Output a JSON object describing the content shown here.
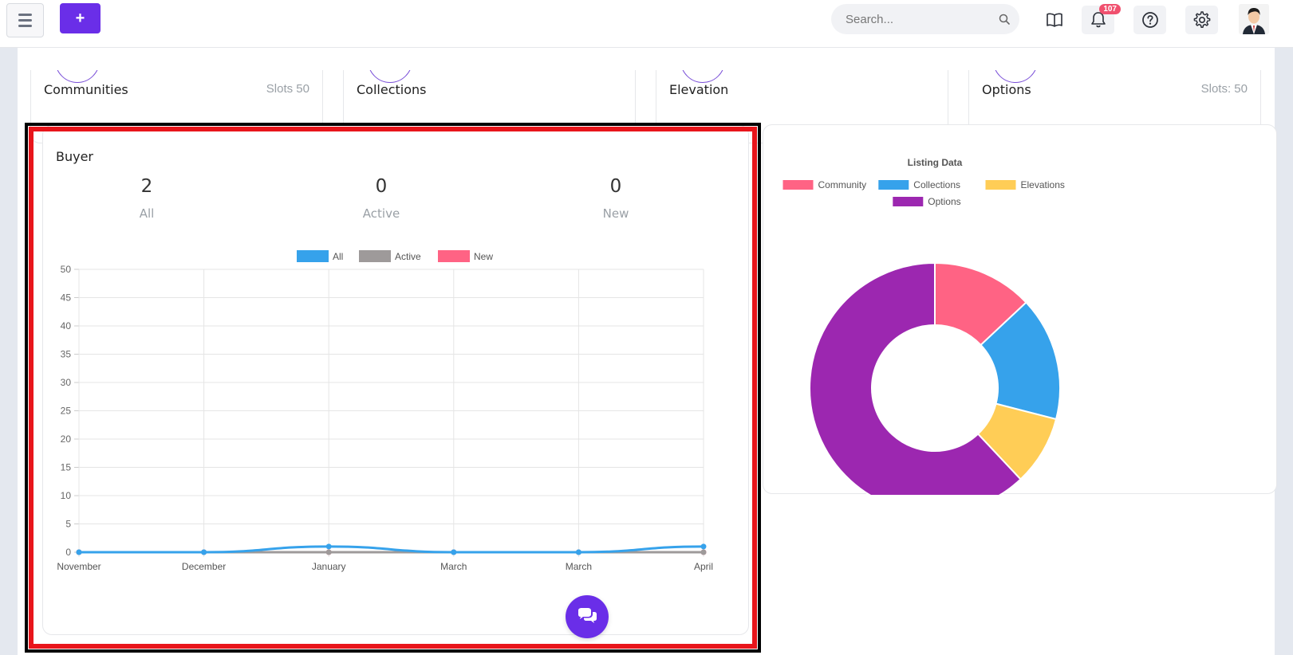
{
  "topbar": {
    "add_label": "+",
    "search_placeholder": "Search...",
    "notification_count": "107"
  },
  "stats": [
    {
      "title": "Communities",
      "slots": "Slots 50"
    },
    {
      "title": "Collections",
      "slots": ""
    },
    {
      "title": "Elevation",
      "slots": ""
    },
    {
      "title": "Options",
      "slots": "Slots: 50"
    }
  ],
  "buyer": {
    "title": "Buyer",
    "metrics": [
      {
        "value": "2",
        "label": "All"
      },
      {
        "value": "0",
        "label": "Active"
      },
      {
        "value": "0",
        "label": "New"
      }
    ]
  },
  "icons": {
    "menu": "hamburger-icon",
    "search": "search-icon",
    "guide": "book-icon",
    "notifications": "bell-icon",
    "help": "question-icon",
    "settings": "gear-icon",
    "chat": "chat-icon"
  },
  "colors": {
    "accent": "#6a2ee8",
    "highlight_red": "#e8151b",
    "all": "#36a2eb",
    "active": "#9e9a9a",
    "new": "#ff6384",
    "elevations": "#ffcd56",
    "options": "#9c27b0"
  },
  "chart_data": [
    {
      "type": "line",
      "categories": [
        "November",
        "December",
        "January",
        "March",
        "March",
        "April"
      ],
      "series": [
        {
          "name": "All",
          "color": "#36a2eb",
          "values": [
            0,
            0,
            1,
            0,
            0,
            1
          ]
        },
        {
          "name": "Active",
          "color": "#9e9a9a",
          "values": [
            0,
            0,
            0,
            0,
            0,
            0
          ]
        },
        {
          "name": "New",
          "color": "#ff6384",
          "values": [
            0,
            0,
            0,
            0,
            0,
            0
          ]
        }
      ],
      "ylim": [
        0,
        50
      ],
      "yticks": [
        0,
        5,
        10,
        15,
        20,
        25,
        30,
        35,
        40,
        45,
        50
      ],
      "grid": true,
      "legend": "top-center"
    },
    {
      "type": "pie",
      "title": "Listing Data",
      "labels": [
        "Community",
        "Collections",
        "Elevations",
        "Options"
      ],
      "colors": [
        "#ff6384",
        "#36a2eb",
        "#ffcd56",
        "#9c27b0"
      ],
      "values": [
        13,
        16,
        9,
        62
      ],
      "donut": true,
      "legend": "top"
    }
  ]
}
